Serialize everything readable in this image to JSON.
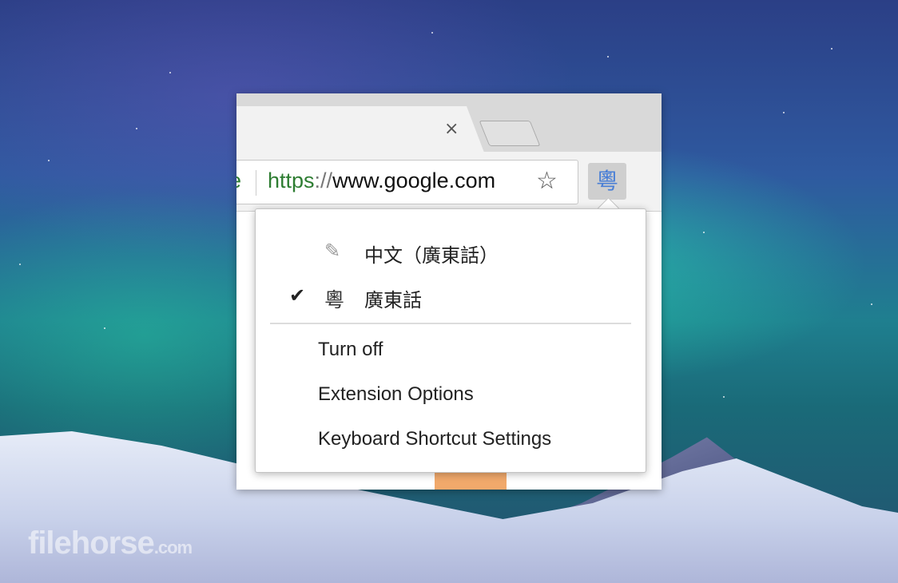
{
  "browser": {
    "omnibox_prefix": "e",
    "url_scheme": "https",
    "url_sep": "://",
    "url_host": "www.google.com",
    "tab_close_glyph": "×",
    "star_glyph": "☆",
    "extension_icon_char": "粵",
    "extension_icon_color": "#4a7fd6"
  },
  "menu": {
    "modes": [
      {
        "icon": "pencil-icon",
        "glyph": "✎",
        "label": "中文（廣東話）",
        "checked": false
      },
      {
        "icon": "yue-char-icon",
        "glyph": "粵",
        "label": "廣東話",
        "checked": true,
        "check_glyph": "✔"
      }
    ],
    "actions": [
      {
        "label": "Turn off"
      },
      {
        "label": "Extension Options"
      },
      {
        "label": "Keyboard Shortcut Settings"
      }
    ]
  },
  "watermark": {
    "brand": "filehorse",
    "suffix": ".com"
  }
}
